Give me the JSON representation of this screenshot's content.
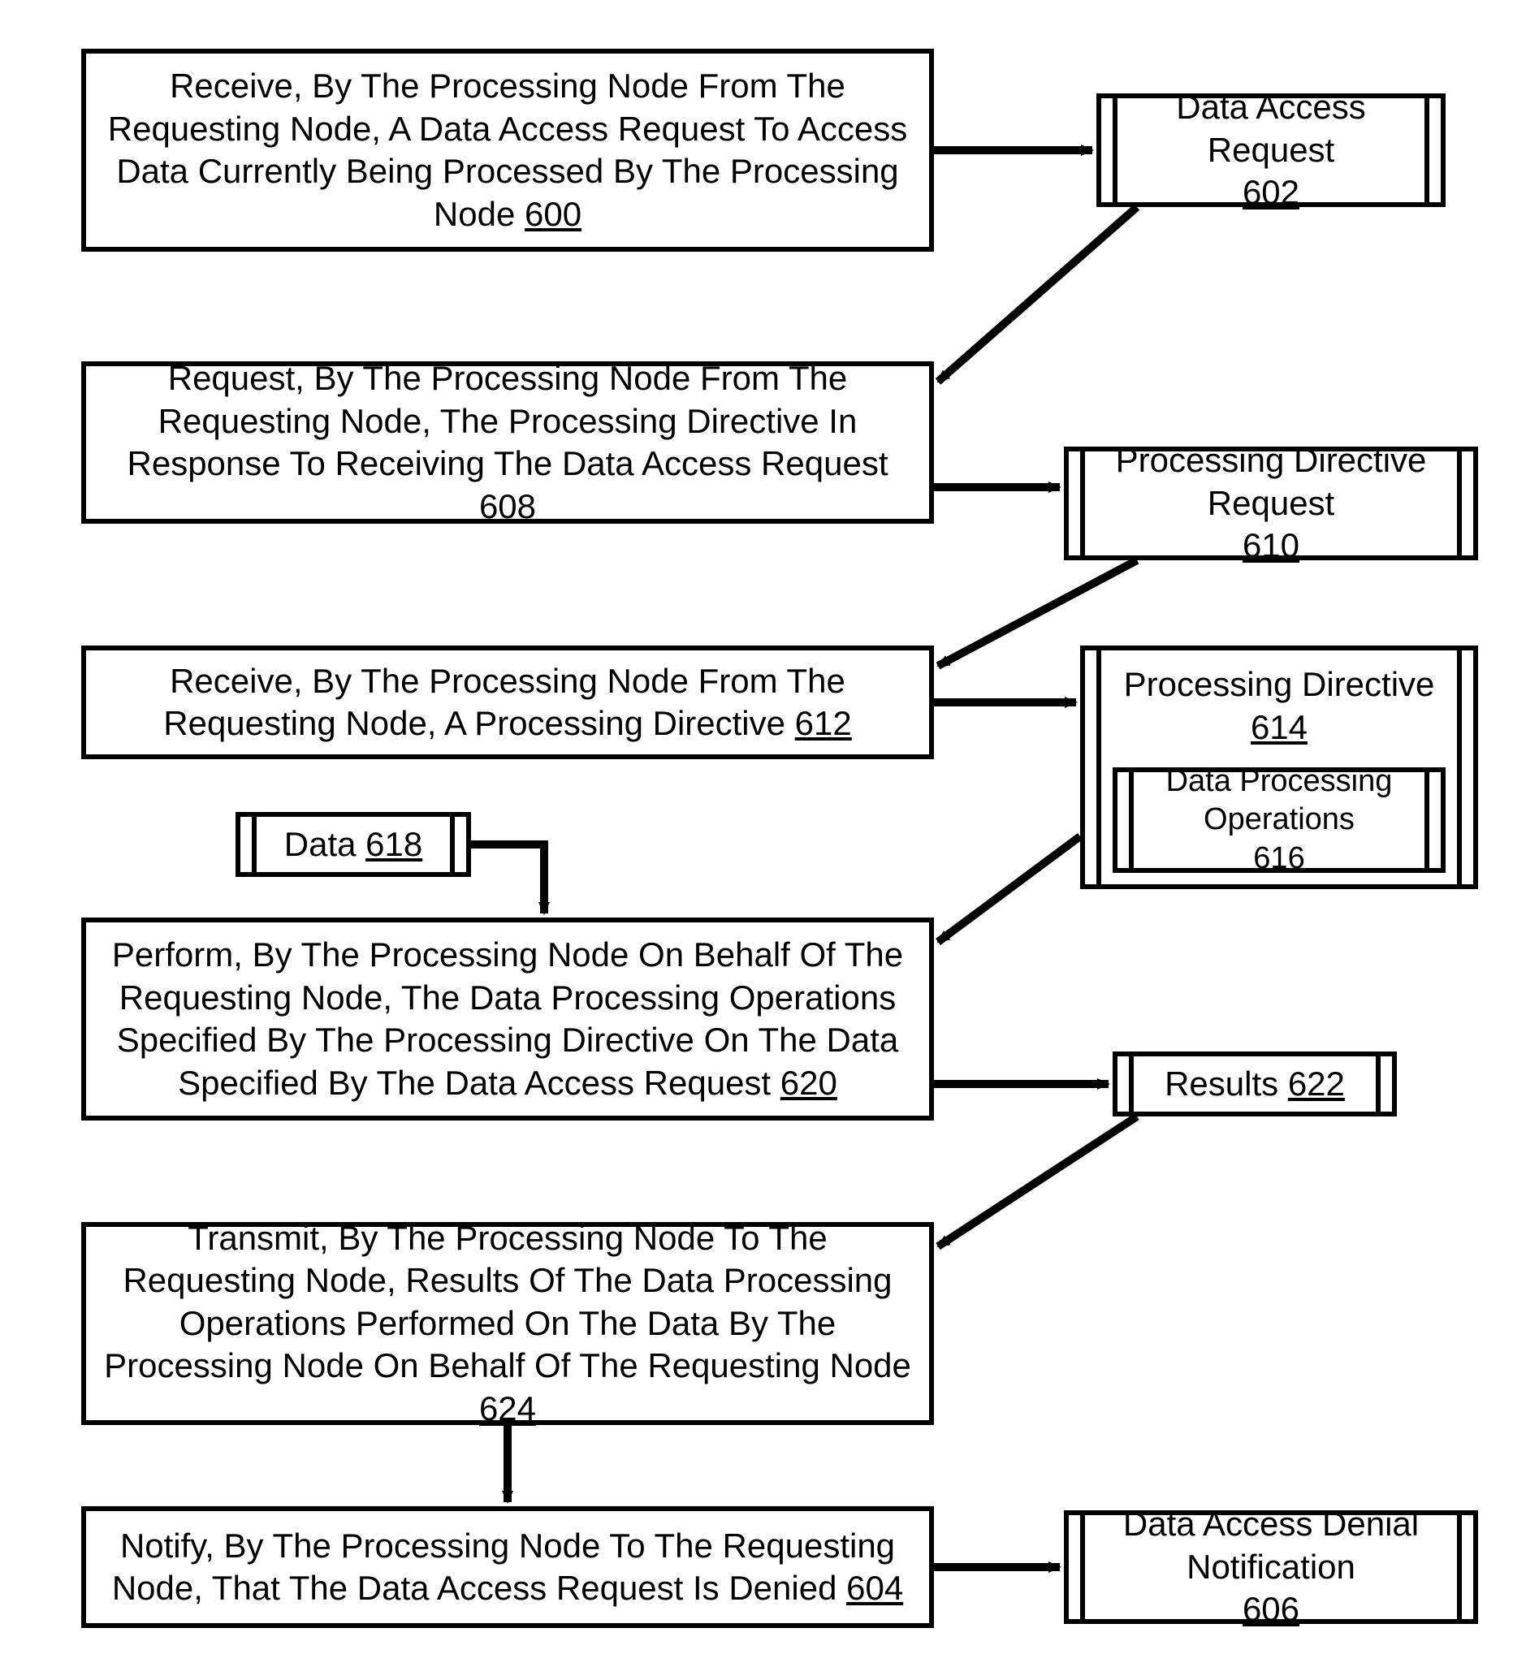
{
  "steps": {
    "s600": {
      "text": "Receive, By The Processing Node From The Requesting Node, A Data Access Request To Access Data Currently Being Processed By The Processing Node",
      "num": "600"
    },
    "s608": {
      "text": "Request, By The Processing Node From The Requesting Node, The Processing Directive In Response To Receiving The Data Access Request",
      "num": "608"
    },
    "s612": {
      "text": "Receive, By The Processing Node From The Requesting Node, A Processing Directive",
      "num": "612"
    },
    "s620": {
      "text": "Perform, By The Processing Node On Behalf Of The Requesting Node, The Data Processing Operations Specified By The Processing Directive On The Data Specified By The Data Access Request",
      "num": "620"
    },
    "s624": {
      "text": "Transmit, By The Processing Node To The Requesting Node, Results Of The Data Processing Operations Performed On The Data By The Processing Node On Behalf Of The Requesting Node",
      "num": "624"
    },
    "s604": {
      "text": "Notify, By The Processing Node To The Requesting Node, That The Data Access Request Is Denied",
      "num": "604"
    }
  },
  "data": {
    "d602": {
      "label": "Data Access Request",
      "num": "602"
    },
    "d610": {
      "label": "Processing Directive Request",
      "num": "610"
    },
    "d614": {
      "label": "Processing Directive",
      "num": "614"
    },
    "d616": {
      "label": "Data Processing Operations",
      "num": "616"
    },
    "d618": {
      "label": "Data",
      "num": "618"
    },
    "d622": {
      "label": "Results",
      "num": "622"
    },
    "d606": {
      "label": "Data Access Denial Notification",
      "num": "606"
    }
  }
}
